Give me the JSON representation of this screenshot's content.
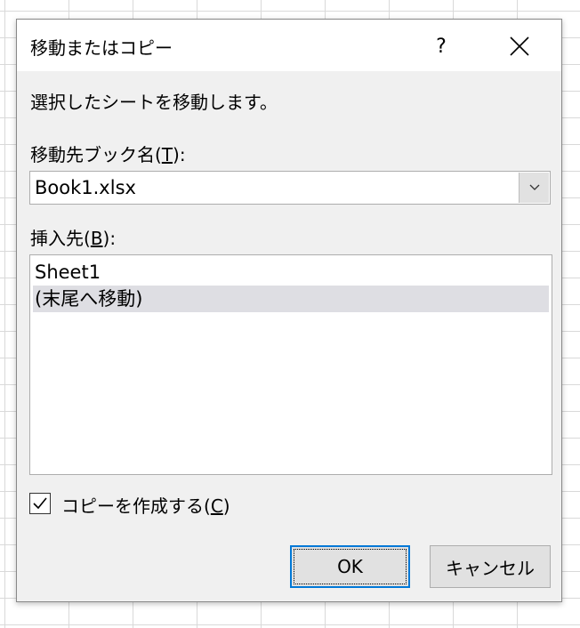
{
  "dialog": {
    "title": "移動またはコピー",
    "help": "?",
    "instruction": "選択したシートを移動します。",
    "book_label": "移動先ブック名(",
    "book_key": "T",
    "book_close": "):",
    "book_value": "Book1.xlsx",
    "insert_label": "挿入先(",
    "insert_key": "B",
    "insert_close": "):",
    "sheets": [
      "Sheet1",
      "(末尾へ移動)"
    ],
    "copy_label": "コピーを作成する(",
    "copy_key": "C",
    "copy_close": ")",
    "copy_checked": true,
    "ok_label": "OK",
    "cancel_label": "キャンセル",
    "accent_color": "#0078d7"
  }
}
